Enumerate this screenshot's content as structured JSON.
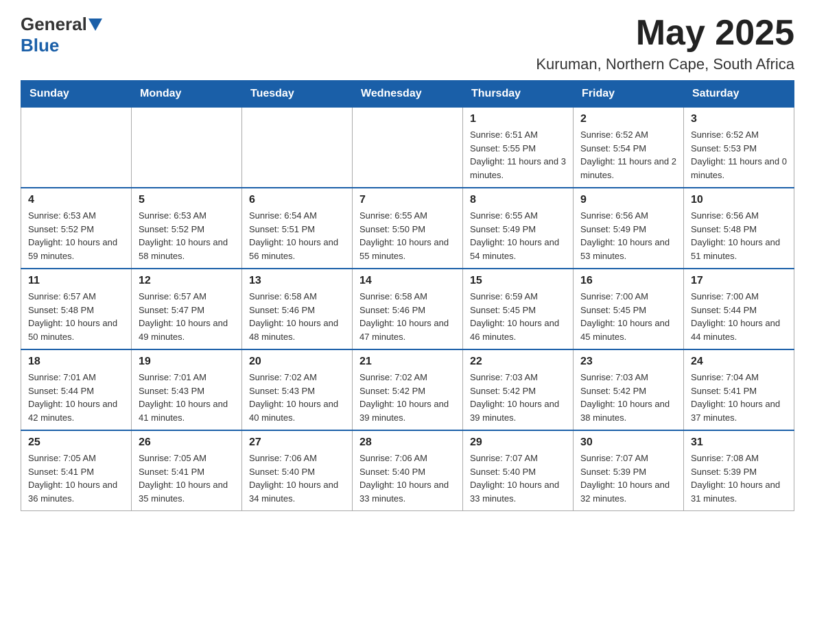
{
  "header": {
    "logo_general": "General",
    "logo_blue": "Blue",
    "month_title": "May 2025",
    "location": "Kuruman, Northern Cape, South Africa"
  },
  "weekdays": [
    "Sunday",
    "Monday",
    "Tuesday",
    "Wednesday",
    "Thursday",
    "Friday",
    "Saturday"
  ],
  "weeks": [
    [
      {
        "day": "",
        "info": ""
      },
      {
        "day": "",
        "info": ""
      },
      {
        "day": "",
        "info": ""
      },
      {
        "day": "",
        "info": ""
      },
      {
        "day": "1",
        "info": "Sunrise: 6:51 AM\nSunset: 5:55 PM\nDaylight: 11 hours and 3 minutes."
      },
      {
        "day": "2",
        "info": "Sunrise: 6:52 AM\nSunset: 5:54 PM\nDaylight: 11 hours and 2 minutes."
      },
      {
        "day": "3",
        "info": "Sunrise: 6:52 AM\nSunset: 5:53 PM\nDaylight: 11 hours and 0 minutes."
      }
    ],
    [
      {
        "day": "4",
        "info": "Sunrise: 6:53 AM\nSunset: 5:52 PM\nDaylight: 10 hours and 59 minutes."
      },
      {
        "day": "5",
        "info": "Sunrise: 6:53 AM\nSunset: 5:52 PM\nDaylight: 10 hours and 58 minutes."
      },
      {
        "day": "6",
        "info": "Sunrise: 6:54 AM\nSunset: 5:51 PM\nDaylight: 10 hours and 56 minutes."
      },
      {
        "day": "7",
        "info": "Sunrise: 6:55 AM\nSunset: 5:50 PM\nDaylight: 10 hours and 55 minutes."
      },
      {
        "day": "8",
        "info": "Sunrise: 6:55 AM\nSunset: 5:49 PM\nDaylight: 10 hours and 54 minutes."
      },
      {
        "day": "9",
        "info": "Sunrise: 6:56 AM\nSunset: 5:49 PM\nDaylight: 10 hours and 53 minutes."
      },
      {
        "day": "10",
        "info": "Sunrise: 6:56 AM\nSunset: 5:48 PM\nDaylight: 10 hours and 51 minutes."
      }
    ],
    [
      {
        "day": "11",
        "info": "Sunrise: 6:57 AM\nSunset: 5:48 PM\nDaylight: 10 hours and 50 minutes."
      },
      {
        "day": "12",
        "info": "Sunrise: 6:57 AM\nSunset: 5:47 PM\nDaylight: 10 hours and 49 minutes."
      },
      {
        "day": "13",
        "info": "Sunrise: 6:58 AM\nSunset: 5:46 PM\nDaylight: 10 hours and 48 minutes."
      },
      {
        "day": "14",
        "info": "Sunrise: 6:58 AM\nSunset: 5:46 PM\nDaylight: 10 hours and 47 minutes."
      },
      {
        "day": "15",
        "info": "Sunrise: 6:59 AM\nSunset: 5:45 PM\nDaylight: 10 hours and 46 minutes."
      },
      {
        "day": "16",
        "info": "Sunrise: 7:00 AM\nSunset: 5:45 PM\nDaylight: 10 hours and 45 minutes."
      },
      {
        "day": "17",
        "info": "Sunrise: 7:00 AM\nSunset: 5:44 PM\nDaylight: 10 hours and 44 minutes."
      }
    ],
    [
      {
        "day": "18",
        "info": "Sunrise: 7:01 AM\nSunset: 5:44 PM\nDaylight: 10 hours and 42 minutes."
      },
      {
        "day": "19",
        "info": "Sunrise: 7:01 AM\nSunset: 5:43 PM\nDaylight: 10 hours and 41 minutes."
      },
      {
        "day": "20",
        "info": "Sunrise: 7:02 AM\nSunset: 5:43 PM\nDaylight: 10 hours and 40 minutes."
      },
      {
        "day": "21",
        "info": "Sunrise: 7:02 AM\nSunset: 5:42 PM\nDaylight: 10 hours and 39 minutes."
      },
      {
        "day": "22",
        "info": "Sunrise: 7:03 AM\nSunset: 5:42 PM\nDaylight: 10 hours and 39 minutes."
      },
      {
        "day": "23",
        "info": "Sunrise: 7:03 AM\nSunset: 5:42 PM\nDaylight: 10 hours and 38 minutes."
      },
      {
        "day": "24",
        "info": "Sunrise: 7:04 AM\nSunset: 5:41 PM\nDaylight: 10 hours and 37 minutes."
      }
    ],
    [
      {
        "day": "25",
        "info": "Sunrise: 7:05 AM\nSunset: 5:41 PM\nDaylight: 10 hours and 36 minutes."
      },
      {
        "day": "26",
        "info": "Sunrise: 7:05 AM\nSunset: 5:41 PM\nDaylight: 10 hours and 35 minutes."
      },
      {
        "day": "27",
        "info": "Sunrise: 7:06 AM\nSunset: 5:40 PM\nDaylight: 10 hours and 34 minutes."
      },
      {
        "day": "28",
        "info": "Sunrise: 7:06 AM\nSunset: 5:40 PM\nDaylight: 10 hours and 33 minutes."
      },
      {
        "day": "29",
        "info": "Sunrise: 7:07 AM\nSunset: 5:40 PM\nDaylight: 10 hours and 33 minutes."
      },
      {
        "day": "30",
        "info": "Sunrise: 7:07 AM\nSunset: 5:39 PM\nDaylight: 10 hours and 32 minutes."
      },
      {
        "day": "31",
        "info": "Sunrise: 7:08 AM\nSunset: 5:39 PM\nDaylight: 10 hours and 31 minutes."
      }
    ]
  ]
}
